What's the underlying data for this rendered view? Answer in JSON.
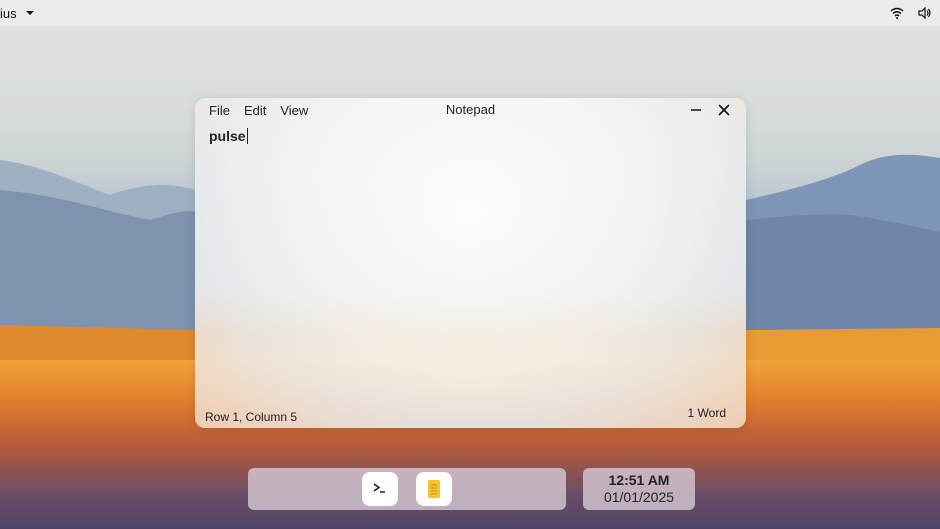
{
  "topbar": {
    "app_label": "ius",
    "icons": [
      "chevron-down-icon",
      "wifi-icon",
      "volume-icon"
    ]
  },
  "window": {
    "title": "Notepad",
    "menu": [
      "File",
      "Edit",
      "View"
    ],
    "content": "pulse",
    "status_left": "Row 1, Column 5",
    "status_right": "1 Word",
    "controls": [
      "minimize-icon",
      "close-icon"
    ]
  },
  "dock": {
    "apps": [
      {
        "name": "terminal",
        "icon": "terminal-icon"
      },
      {
        "name": "notepad",
        "icon": "notepad-icon",
        "color": "#f2c230"
      }
    ]
  },
  "clock": {
    "time": "12:51 AM",
    "date": "01/01/2025"
  },
  "colors": {
    "accent_sunset": "#f2a43a",
    "mountain_blue": "#8ea3bd"
  }
}
